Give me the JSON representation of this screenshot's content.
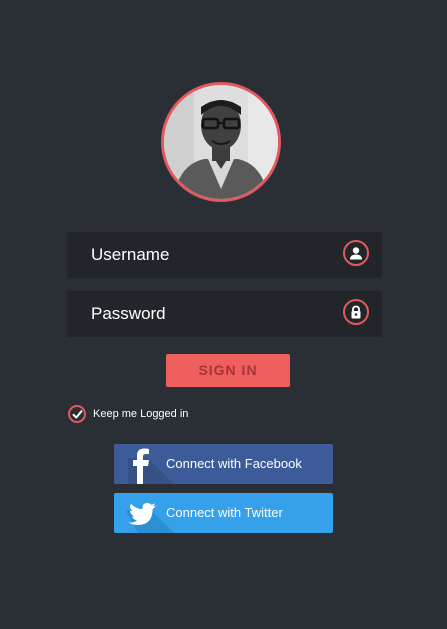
{
  "profile": {
    "avatar_icon": "user-portrait"
  },
  "form": {
    "username_placeholder": "Username",
    "password_placeholder": "Password",
    "username_icon": "user-icon",
    "password_icon": "lock-icon",
    "signin_label": "SIGN IN",
    "remember_label": "Keep me Logged in",
    "remember_checked": true
  },
  "social": {
    "facebook_label": "Connect with Facebook",
    "twitter_label": "Connect with Twitter"
  },
  "colors": {
    "background": "#2a2e35",
    "field_bg": "#22252a",
    "accent": "#e2595e",
    "signin_bg": "#ef5f5e",
    "facebook": "#3d5b99",
    "twitter": "#34a1ea"
  }
}
